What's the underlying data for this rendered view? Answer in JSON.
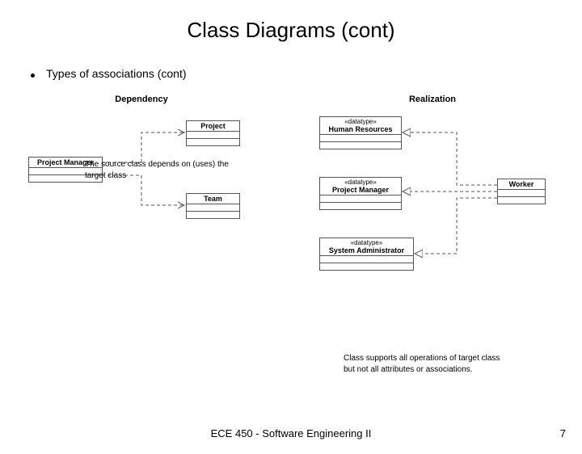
{
  "title": "Class Diagrams (cont)",
  "bullet": "Types of associations (cont)",
  "left": {
    "heading": "Dependency",
    "caption": "The source class depends on (uses) the target class",
    "classes": {
      "pm": "Project Manager",
      "project": "Project",
      "team": "Team"
    }
  },
  "right": {
    "heading": "Realization",
    "caption": "Class supports all operations of target class but not all attributes or associations.",
    "stereo": "«datatype»",
    "classes": {
      "hr": "Human Resources",
      "pm": "Project Manager",
      "sa": "System Administrator",
      "worker": "Worker"
    }
  },
  "footer": "ECE 450 - Software Engineering II",
  "page": "7"
}
